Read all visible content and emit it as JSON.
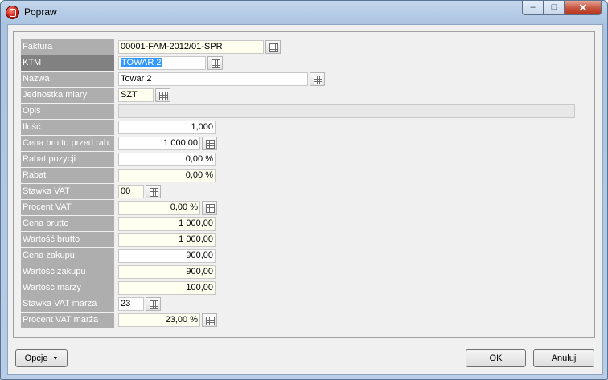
{
  "window": {
    "title": "Popraw",
    "minimize": "–",
    "maximize": "□",
    "close": "✕"
  },
  "form": {
    "faktura": {
      "label": "Faktura",
      "value": "00001-FAM-2012/01-SPR"
    },
    "ktm": {
      "label": "KTM",
      "value": "TOWAR 2"
    },
    "nazwa": {
      "label": "Nazwa",
      "value": "Towar 2"
    },
    "jednostka": {
      "label": "Jednostka miary",
      "value": "SZT"
    },
    "opis": {
      "label": "Opis",
      "value": ""
    },
    "ilosc": {
      "label": "Ilość",
      "value": "1,000"
    },
    "cena_brutto_przed": {
      "label": "Cena brutto przed rab.",
      "value": "1 000,00"
    },
    "rabat_pozycji": {
      "label": "Rabat pozycji",
      "value": "0,00 %"
    },
    "rabat": {
      "label": "Rabat",
      "value": "0,00 %"
    },
    "stawka_vat": {
      "label": "Stawka VAT",
      "value": "00"
    },
    "procent_vat": {
      "label": "Procent VAT",
      "value": "0,00 %"
    },
    "cena_brutto": {
      "label": "Cena brutto",
      "value": "1 000,00"
    },
    "wartosc_brutto": {
      "label": "Wartość brutto",
      "value": "1 000,00"
    },
    "cena_zakupu": {
      "label": "Cena zakupu",
      "value": "900,00"
    },
    "wartosc_zakupu": {
      "label": "Wartość zakupu",
      "value": "900,00"
    },
    "wartosc_marzy": {
      "label": "Wartość marży",
      "value": "100,00"
    },
    "stawka_vat_marza": {
      "label": "Stawka VAT marża",
      "value": "23"
    },
    "procent_vat_marza": {
      "label": "Procent VAT marża",
      "value": "23,00 %"
    }
  },
  "footer": {
    "options_label": "Opcje",
    "ok_label": "OK",
    "cancel_label": "Anuluj"
  }
}
